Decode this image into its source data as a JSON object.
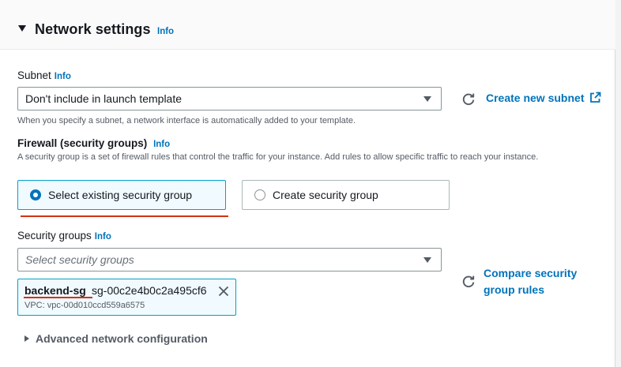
{
  "section": {
    "title": "Network settings",
    "info": "Info"
  },
  "subnet": {
    "label": "Subnet",
    "info": "Info",
    "selected": "Don't include in launch template",
    "help": "When you specify a subnet, a network interface is automatically added to your template.",
    "create_link": "Create new subnet"
  },
  "firewall": {
    "label": "Firewall (security groups)",
    "info": "Info",
    "description": "A security group is a set of firewall rules that control the traffic for your instance. Add rules to allow specific traffic to reach your instance.",
    "options": [
      {
        "label": "Select existing security group",
        "selected": true
      },
      {
        "label": "Create security group",
        "selected": false
      }
    ]
  },
  "security_groups": {
    "label": "Security groups",
    "info": "Info",
    "placeholder": "Select security groups",
    "compare_link_line1": "Compare security",
    "compare_link_line2": "group rules",
    "token": {
      "name": "backend-sg",
      "id": "sg-00c2e4b0c2a495cf6",
      "vpc": "VPC: vpc-00d010ccd559a6575"
    }
  },
  "advanced": {
    "label": "Advanced network configuration"
  },
  "colors": {
    "link": "#0073bb",
    "accent_border": "#00a1c9",
    "annotation_red": "#d13212"
  }
}
